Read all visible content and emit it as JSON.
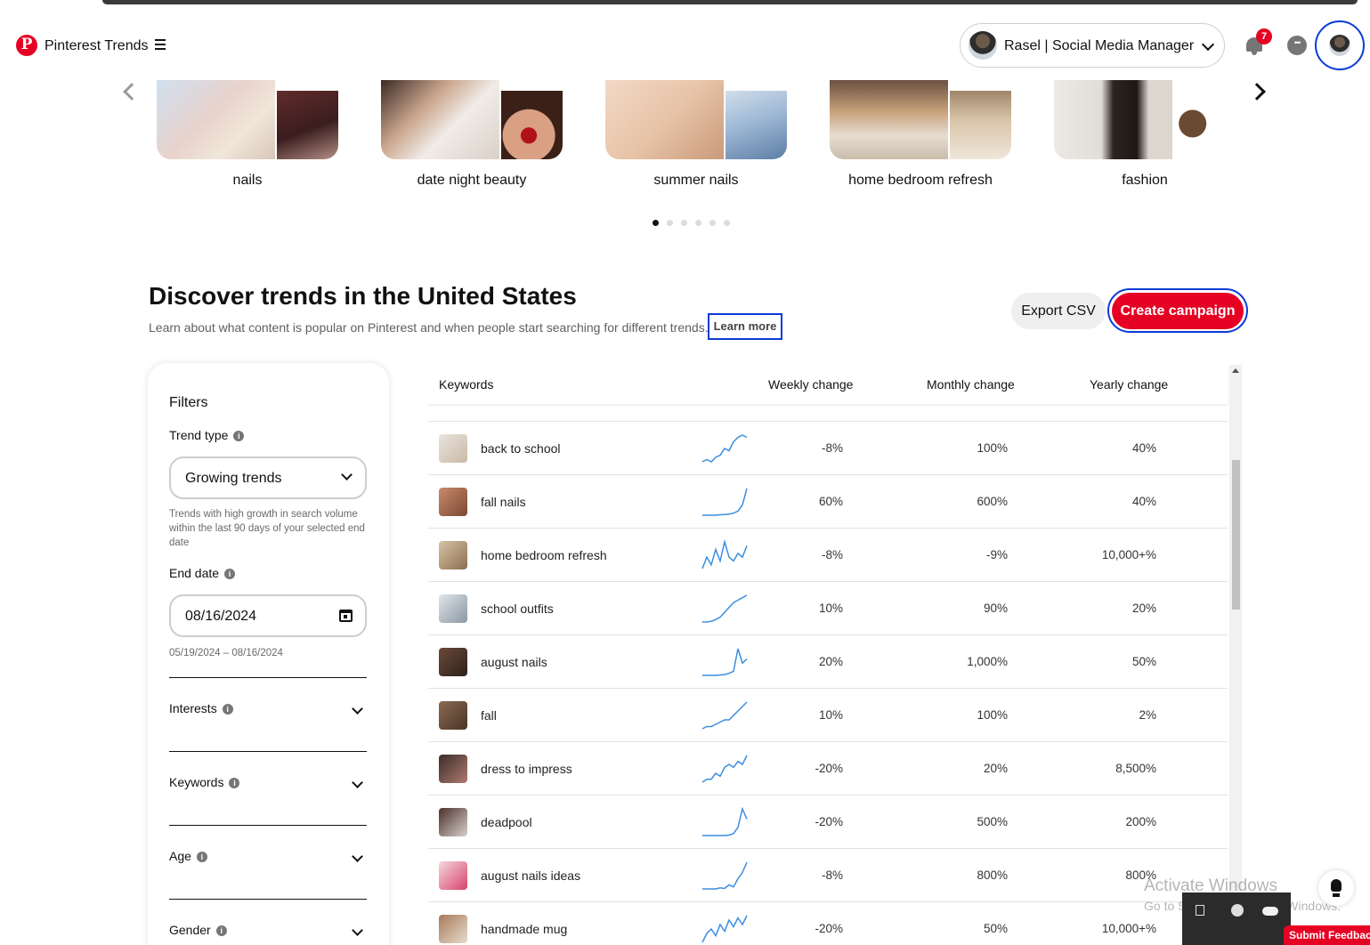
{
  "header": {
    "brand": "Pinterest Trends",
    "account_name": "Rasel | Social Media Manager",
    "notification_count": "7"
  },
  "carousel": {
    "items": [
      {
        "label": "nails"
      },
      {
        "label": "date night beauty"
      },
      {
        "label": "summer nails"
      },
      {
        "label": "home bedroom refresh"
      },
      {
        "label": "fashion"
      }
    ],
    "page_dots": 6,
    "active_dot": 1
  },
  "discover": {
    "title": "Discover trends in the United States",
    "subtitle": "Learn about what content is popular on Pinterest and when people start searching for different trends.",
    "learn_more": "Learn more",
    "export_label": "Export CSV",
    "create_label": "Create campaign"
  },
  "filters": {
    "title": "Filters",
    "trend_type_label": "Trend type",
    "trend_type_value": "Growing trends",
    "trend_type_help": "Trends with high growth in search volume within the last 90 days of your selected end date",
    "end_date_label": "End date",
    "end_date_value": "08/16/2024",
    "date_range": "05/19/2024 – 08/16/2024",
    "interests_label": "Interests",
    "keywords_label": "Keywords",
    "age_label": "Age",
    "gender_label": "Gender"
  },
  "table": {
    "headers": {
      "keywords": "Keywords",
      "weekly": "Weekly change",
      "monthly": "Monthly change",
      "yearly": "Yearly change"
    },
    "rows": [
      {
        "keyword": "back to school",
        "weekly": "-8%",
        "monthly": "100%",
        "yearly": "40%",
        "thumb": [
          "#e8e4df",
          "#cbb9a5"
        ],
        "trend": [
          3,
          4,
          3,
          5,
          6,
          9,
          8,
          12,
          14,
          15,
          14
        ]
      },
      {
        "keyword": "fall nails",
        "weekly": "60%",
        "monthly": "600%",
        "yearly": "40%",
        "thumb": [
          "#c98a6b",
          "#7a4a34"
        ],
        "trend": [
          1,
          1,
          1,
          1,
          1.2,
          1.3,
          1.5,
          2,
          3,
          6,
          14
        ]
      },
      {
        "keyword": "home bedroom refresh",
        "weekly": "-8%",
        "monthly": "-9%",
        "yearly": "10,000+%",
        "thumb": [
          "#d7c2a5",
          "#8c6e4f"
        ],
        "trend": [
          4,
          7,
          5,
          9,
          6,
          11,
          7,
          6,
          8,
          7,
          10
        ]
      },
      {
        "keyword": "school outfits",
        "weekly": "10%",
        "monthly": "90%",
        "yearly": "20%",
        "thumb": [
          "#dfe5ea",
          "#8a97a3"
        ],
        "trend": [
          2,
          2,
          2.3,
          3,
          4,
          6,
          8,
          10,
          11,
          12,
          13
        ]
      },
      {
        "keyword": "august nails",
        "weekly": "20%",
        "monthly": "1,000%",
        "yearly": "50%",
        "thumb": [
          "#6b4a3a",
          "#2e211b"
        ],
        "trend": [
          1,
          1,
          1,
          1,
          1.2,
          1.4,
          2,
          3,
          14,
          7,
          9
        ]
      },
      {
        "keyword": "fall",
        "weekly": "10%",
        "monthly": "100%",
        "yearly": "2%",
        "thumb": [
          "#8a6a52",
          "#4a3526"
        ],
        "trend": [
          2,
          3,
          3,
          4,
          5,
          6,
          6,
          8,
          10,
          12,
          14
        ]
      },
      {
        "keyword": "dress to impress",
        "weekly": "-20%",
        "monthly": "20%",
        "yearly": "8,500%",
        "thumb": [
          "#3a2c2a",
          "#b07a70"
        ],
        "trend": [
          3,
          4,
          4,
          6,
          5,
          8,
          9,
          8,
          10,
          9,
          12
        ]
      },
      {
        "keyword": "deadpool",
        "weekly": "-20%",
        "monthly": "500%",
        "yearly": "200%",
        "thumb": [
          "#4a2f2a",
          "#d8d0cc"
        ],
        "trend": [
          1,
          1,
          1,
          1,
          1,
          1,
          1.2,
          2,
          5,
          14,
          9
        ]
      },
      {
        "keyword": "august nails ideas",
        "weekly": "-8%",
        "monthly": "800%",
        "yearly": "800%",
        "thumb": [
          "#f4d7df",
          "#d9436a"
        ],
        "trend": [
          1,
          1,
          1,
          1,
          1.5,
          1.2,
          3,
          2,
          6,
          9,
          14
        ]
      },
      {
        "keyword": "handmade mug",
        "weekly": "-20%",
        "monthly": "50%",
        "yearly": "10,000+%",
        "thumb": [
          "#a87a5a",
          "#e8dccd"
        ],
        "trend": [
          1,
          5,
          7,
          4,
          9,
          6,
          11,
          8,
          12,
          9,
          13
        ]
      }
    ]
  },
  "overlays": {
    "activate_title": "Activate Windows",
    "activate_sub": "Go to Settings to activate Windows.",
    "feedback": "Submit Feedback"
  },
  "colors": {
    "brand_red": "#e60023",
    "focus_ring": "#0a3bd8",
    "spark_line": "#3b8de0"
  },
  "icons": {
    "logo": "pinterest-logo-icon",
    "menu": "hamburger-menu-icon",
    "notifications": "bell-icon",
    "messages": "chat-bubble-icon",
    "calendar": "calendar-icon",
    "idea": "lightbulb-icon"
  }
}
